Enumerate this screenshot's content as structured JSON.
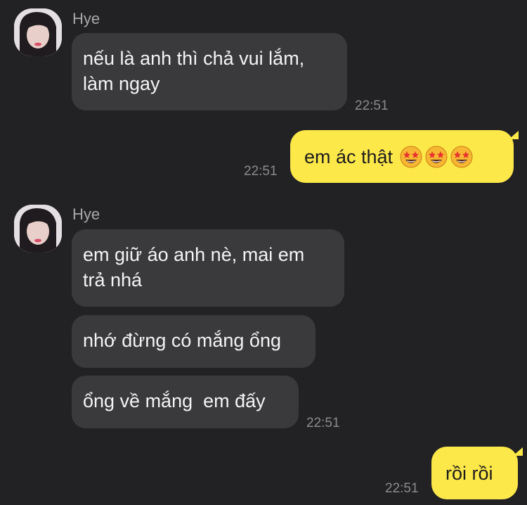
{
  "colors": {
    "background": "#222224",
    "incoming_bubble": "#3a3a3d",
    "outgoing_bubble": "#fde84a",
    "incoming_text": "#f4f4f4",
    "outgoing_text": "#1d1d1d",
    "timestamp": "#8b8b8f",
    "sender_name": "#a8a8ac"
  },
  "messages": [
    {
      "sender": "Hye",
      "direction": "incoming",
      "bubbles": [
        "nếu là anh thì chả vui lắm,\nlàm ngay"
      ],
      "time": "22:51"
    },
    {
      "direction": "outgoing",
      "text": "em ác thật",
      "emoji": [
        "star-struck-icon",
        "star-struck-icon",
        "star-struck-icon"
      ],
      "time": "22:51"
    },
    {
      "sender": "Hye",
      "direction": "incoming",
      "bubbles": [
        "em giữ áo anh nè, mai em\ntrả nhá",
        "nhớ đừng có mắng ổng",
        "ổng về mắng  em đấy"
      ],
      "time": "22:51"
    },
    {
      "direction": "outgoing",
      "text": "rồi rồi",
      "time": "22:51"
    }
  ]
}
